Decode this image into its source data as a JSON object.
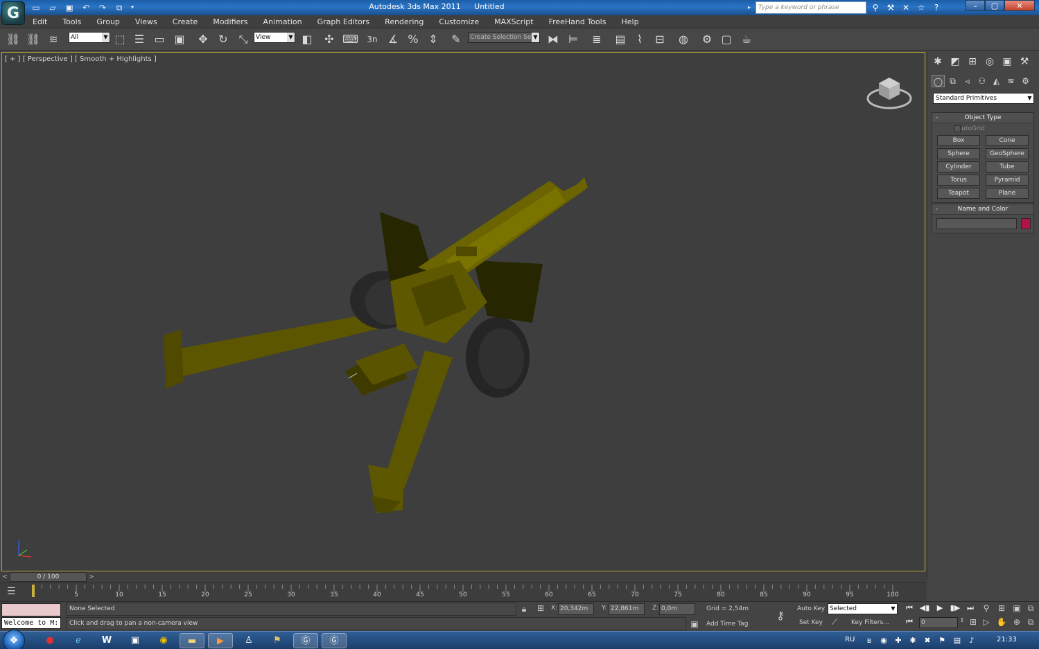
{
  "window": {
    "app_title": "Autodesk 3ds Max 2011",
    "doc_title": "Untitled",
    "search_placeholder": "Type a keyword or phrase",
    "logo_letter": "G",
    "controls": [
      "minimize",
      "maximize",
      "close"
    ]
  },
  "quick_access": [
    "new-icon",
    "open-icon",
    "save-icon",
    "undo-icon",
    "redo-icon",
    "project-icon"
  ],
  "menu": [
    "Edit",
    "Tools",
    "Group",
    "Views",
    "Create",
    "Modifiers",
    "Animation",
    "Graph Editors",
    "Rendering",
    "Customize",
    "MAXScript",
    "FreeHand Tools",
    "Help"
  ],
  "toolbar": {
    "selection_filter": "All",
    "reference_coord": "View",
    "named_selection": "Create Selection Se",
    "snap_value": "3"
  },
  "viewport": {
    "label": "[ + ] [ Perspective ] [ Smooth + Highlights ]",
    "model_color": "#6b6400",
    "border_color": "#b7a53c"
  },
  "command_panel": {
    "tabs": [
      "create-icon",
      "modify-icon",
      "hierarchy-icon",
      "motion-icon",
      "display-icon",
      "utilities-icon"
    ],
    "subtabs": [
      "geometry-icon",
      "shapes-icon",
      "lights-icon",
      "cameras-icon",
      "helpers-icon",
      "spacewarps-icon",
      "systems-icon"
    ],
    "category": "Standard Primitives",
    "object_type": {
      "title": "Object Type",
      "autogrid": "AutoGrid",
      "buttons": [
        "Box",
        "Cone",
        "Sphere",
        "GeoSphere",
        "Cylinder",
        "Tube",
        "Torus",
        "Pyramid",
        "Teapot",
        "Plane"
      ]
    },
    "name_color": {
      "title": "Name and Color",
      "name_value": "",
      "swatch": "#b0124a"
    }
  },
  "timeline": {
    "frame_display": "0 / 100",
    "ticks": [
      "5",
      "10",
      "15",
      "20",
      "25",
      "30",
      "35",
      "40",
      "45",
      "50",
      "55",
      "60",
      "65",
      "70",
      "75",
      "80",
      "85",
      "90",
      "95",
      "100"
    ]
  },
  "status": {
    "listener_text": "Welcome to M:",
    "selection": "None Selected",
    "prompt": "Click and drag to pan a non-camera view",
    "x_label": "X:",
    "x": "20,342m",
    "y_label": "Y:",
    "y": "22,861m",
    "z_label": "Z:",
    "z": "0,0m",
    "grid": "Grid = 2,54m",
    "add_time_tag": "Add Time Tag",
    "auto_key": "Auto Key",
    "set_key": "Set Key",
    "key_mode": "Selected",
    "key_filters": "Key Filters...",
    "current_frame": "0"
  },
  "taskbar": {
    "apps": [
      "opera-icon",
      "ie-icon",
      "word-icon",
      "app-icon",
      "chrome-icon",
      "explorer-icon",
      "media-player-icon",
      "user-icon",
      "app2-icon",
      "3dsmax-icon",
      "3dsmax2-icon"
    ],
    "lang": "RU",
    "time": "21:33"
  }
}
